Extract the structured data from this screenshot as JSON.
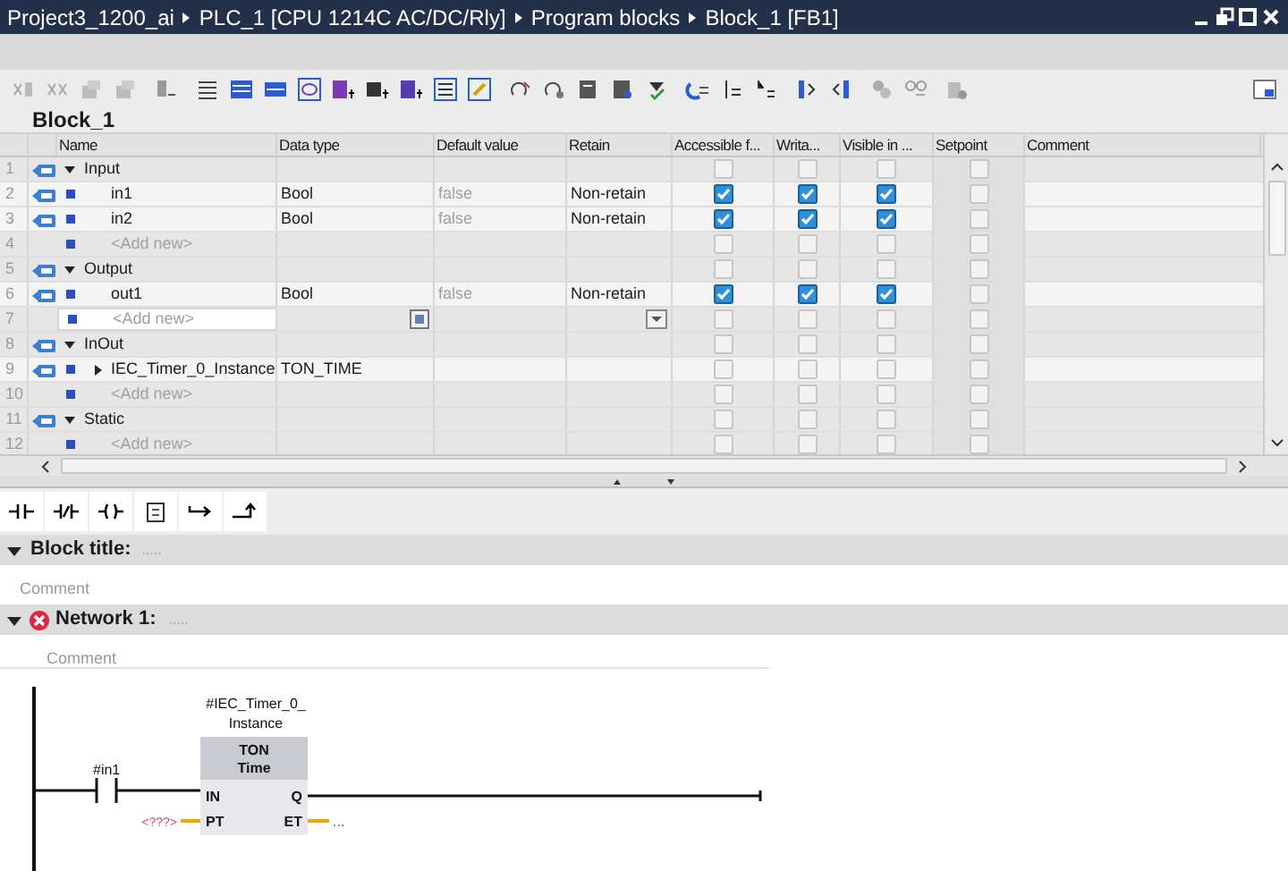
{
  "breadcrumb": [
    "Project3_1200_ai",
    "PLC_1 [CPU 1214C AC/DC/Rly]",
    "Program blocks",
    "Block_1 [FB1]"
  ],
  "block_name": "Block_1",
  "table": {
    "columns": [
      "Name",
      "Data type",
      "Default value",
      "Retain",
      "Accessible f...",
      "Writa...",
      "Visible in ...",
      "Setpoint",
      "Comment"
    ],
    "rows": [
      {
        "num": "1",
        "kind": "section",
        "expanded": true,
        "name": "Input",
        "selected": false,
        "accessible": false,
        "writable": false,
        "visible": false,
        "setpoint": false
      },
      {
        "num": "2",
        "kind": "var",
        "name": "in1",
        "data_type": "Bool",
        "default_value": "false",
        "retain": "Non-retain",
        "selected": false,
        "accessible": true,
        "writable": true,
        "visible": true,
        "setpoint": false
      },
      {
        "num": "3",
        "kind": "var",
        "name": "in2",
        "data_type": "Bool",
        "default_value": "false",
        "retain": "Non-retain",
        "selected": false,
        "accessible": true,
        "writable": true,
        "visible": true,
        "setpoint": false
      },
      {
        "num": "4",
        "kind": "addnew",
        "name": "<Add new>",
        "selected": false,
        "accessible": false,
        "writable": false,
        "visible": false,
        "setpoint": false
      },
      {
        "num": "5",
        "kind": "section",
        "expanded": true,
        "name": "Output",
        "selected": false,
        "accessible": false,
        "writable": false,
        "visible": false,
        "setpoint": false
      },
      {
        "num": "6",
        "kind": "var",
        "name": "out1",
        "data_type": "Bool",
        "default_value": "false",
        "retain": "Non-retain",
        "selected": false,
        "accessible": true,
        "writable": true,
        "visible": true,
        "setpoint": false
      },
      {
        "num": "7",
        "kind": "addnew",
        "name": "<Add new>",
        "selected": true,
        "accessible": false,
        "writable": false,
        "visible": false,
        "setpoint": false
      },
      {
        "num": "8",
        "kind": "section",
        "expanded": true,
        "name": "InOut",
        "selected": false,
        "accessible": false,
        "writable": false,
        "visible": false,
        "setpoint": false
      },
      {
        "num": "9",
        "kind": "struct",
        "expanded": false,
        "name": "IEC_Timer_0_Instance",
        "data_type": "TON_TIME",
        "selected": false,
        "accessible": false,
        "writable": false,
        "visible": false,
        "setpoint": false
      },
      {
        "num": "10",
        "kind": "addnew",
        "name": "<Add new>",
        "selected": false,
        "accessible": false,
        "writable": false,
        "visible": false,
        "setpoint": false
      },
      {
        "num": "11",
        "kind": "section",
        "expanded": true,
        "name": "Static",
        "selected": false,
        "accessible": false,
        "writable": false,
        "visible": false,
        "setpoint": false
      },
      {
        "num": "12",
        "kind": "addnew",
        "name": "<Add new>",
        "selected": false,
        "accessible": false,
        "writable": false,
        "visible": false,
        "setpoint": false
      }
    ]
  },
  "block_title": {
    "label": "Block title:",
    "dots": ".....",
    "comment": "Comment",
    "expanded": true
  },
  "network": {
    "label": "Network 1:",
    "dots": ".....",
    "comment": "Comment",
    "expanded": true,
    "error": true,
    "contact": {
      "operand": "#in1"
    },
    "box": {
      "instance": [
        "#IEC_Timer_0_",
        "Instance"
      ],
      "type": "TON",
      "subtitle": "Time",
      "inputs": [
        {
          "pin": "IN"
        },
        {
          "pin": "PT",
          "value": "<???>"
        }
      ],
      "outputs": [
        {
          "pin": "Q"
        },
        {
          "pin": "ET",
          "value": "..."
        }
      ]
    }
  }
}
